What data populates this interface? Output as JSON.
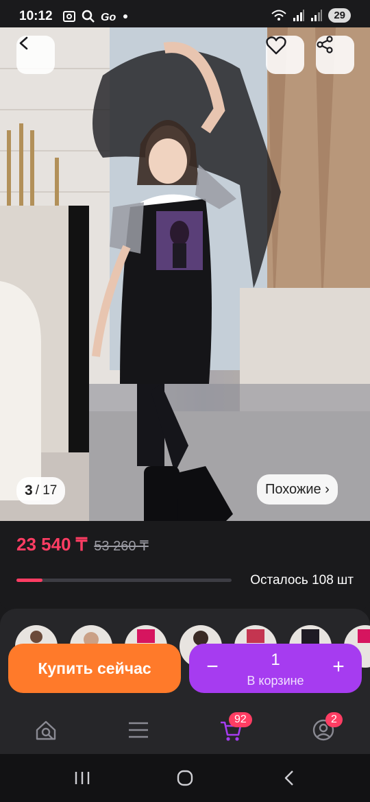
{
  "status_bar": {
    "time": "10:12",
    "battery": "29"
  },
  "gallery": {
    "counter_current": "3",
    "counter_total": "/ 17",
    "similar_label": "Похожие ›"
  },
  "product": {
    "price": "23 540 ₸",
    "old_price": "53 260 ₸",
    "stock_text": "Осталось 108 шт",
    "stock_progress_percent": 12
  },
  "actions": {
    "buy_now": "Купить сейчас",
    "cart_minus": "−",
    "cart_plus": "+",
    "cart_quantity": "1",
    "cart_label": "В корзине"
  },
  "tabbar": {
    "cart_badge": "92",
    "profile_badge": "2"
  },
  "icons": [
    "back-icon",
    "heart-icon",
    "share-icon",
    "search-catalog-icon",
    "menu-icon",
    "cart-icon",
    "profile-icon",
    "recents-icon",
    "home-icon",
    "nav-back-icon"
  ],
  "colors": {
    "accent": "#ff3d63",
    "buy": "#ff7a2a",
    "cart": "#a63cf0",
    "background": "#1a1a1c"
  }
}
